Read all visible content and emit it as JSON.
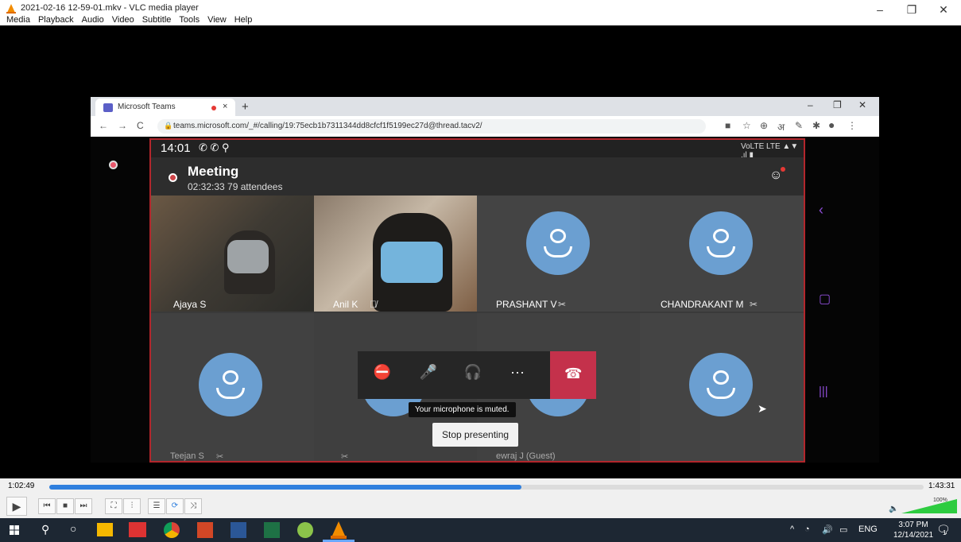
{
  "vlc": {
    "title": "2021-02-16 12-59-01.mkv - VLC media player",
    "menu": [
      "Media",
      "Playback",
      "Audio",
      "Video",
      "Subtitle",
      "Tools",
      "View",
      "Help"
    ],
    "time_elapsed": "1:02:49",
    "time_total": "1:43:31",
    "progress": 0.54,
    "volume": "100%"
  },
  "browser": {
    "tab_title": "Microsoft Teams",
    "tab_close": "×",
    "new_tab": "+",
    "url": "teams.microsoft.com/_#/calling/19:75ecb1b7311344dd8cfcf1f5199ec27d@thread.tacv2/"
  },
  "phone": {
    "clock": "14:01",
    "status_icons": "VoLTE LTE ▲▼ .ıl ▮"
  },
  "meeting": {
    "title": "Meeting",
    "subtitle": "02:32:33  79 attendees",
    "tiles": [
      {
        "name": "Ajaya S",
        "muted": false
      },
      {
        "name": "Anil K",
        "muted": true
      },
      {
        "name": "PRASHANT V",
        "muted": true
      },
      {
        "name": "CHANDRAKANT M",
        "muted": true
      },
      {
        "name": "Teejan S",
        "muted": true
      },
      {
        "name": "",
        "muted": true
      },
      {
        "name": "ewraj J (Guest)",
        "muted": false
      },
      {
        "name": "",
        "muted": false
      }
    ],
    "toast": "Your microphone is muted.",
    "stop_presenting": "Stop presenting"
  },
  "taskbar": {
    "language": "ENG",
    "time": "3:07 PM",
    "date": "12/14/2021",
    "notifications": "1"
  },
  "colors": {
    "accent_red": "#c4314b",
    "avatar_blue": "#6b9fd1",
    "vlc_progress": "#2f7fde"
  }
}
